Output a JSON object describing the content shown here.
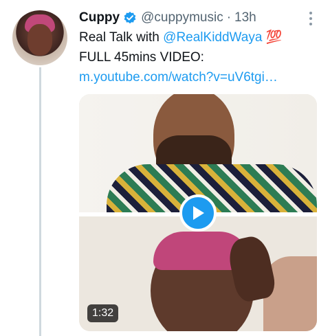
{
  "tweet": {
    "author_name": "Cuppy",
    "handle": "@cuppymusic",
    "separator": "·",
    "time": "13h",
    "text_line1_prefix": "Real Talk with ",
    "mention": "@RealKiddWaya",
    "emoji": "💯",
    "text_line2": "FULL 45mins VIDEO:",
    "link": "m.youtube.com/watch?v=uV6tgi…"
  },
  "media": {
    "duration": "1:32"
  },
  "colors": {
    "accent": "#1d9bf0",
    "text": "#0f1419",
    "secondary": "#536471"
  },
  "icons": {
    "verified": "verified-badge-icon",
    "more": "more-vertical-icon",
    "play": "play-icon"
  }
}
